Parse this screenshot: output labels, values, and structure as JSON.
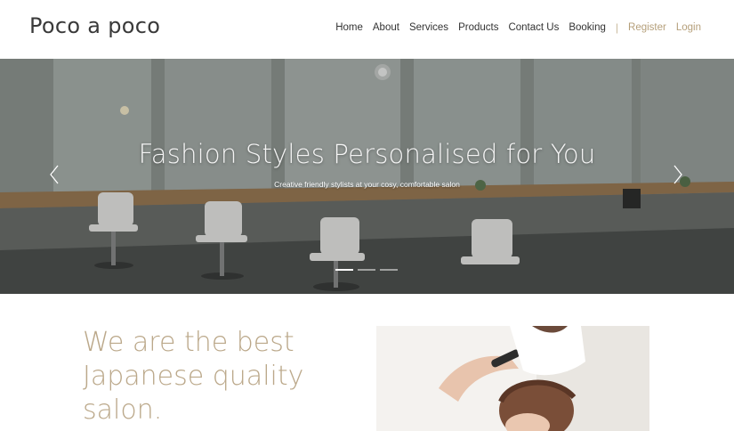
{
  "header": {
    "brand": "Poco a poco",
    "nav": [
      {
        "label": "Home"
      },
      {
        "label": "About"
      },
      {
        "label": "Services"
      },
      {
        "label": "Products"
      },
      {
        "label": "Contact Us"
      },
      {
        "label": "Booking"
      }
    ],
    "separator": "|",
    "register_label": "Register",
    "login_label": "Login"
  },
  "hero": {
    "title": "Fashion Styles Personalised for You",
    "subtitle": "Creative friendly stylists at your cosy, comfortable salon",
    "prev_icon": "chevron-left-icon",
    "next_icon": "chevron-right-icon",
    "slide_count": 3,
    "active_slide": 1
  },
  "about": {
    "heading": "We are the best Japanese quality salon."
  },
  "colors": {
    "accent": "#b59f7a",
    "heading": "#bba88a",
    "text": "#333333"
  }
}
